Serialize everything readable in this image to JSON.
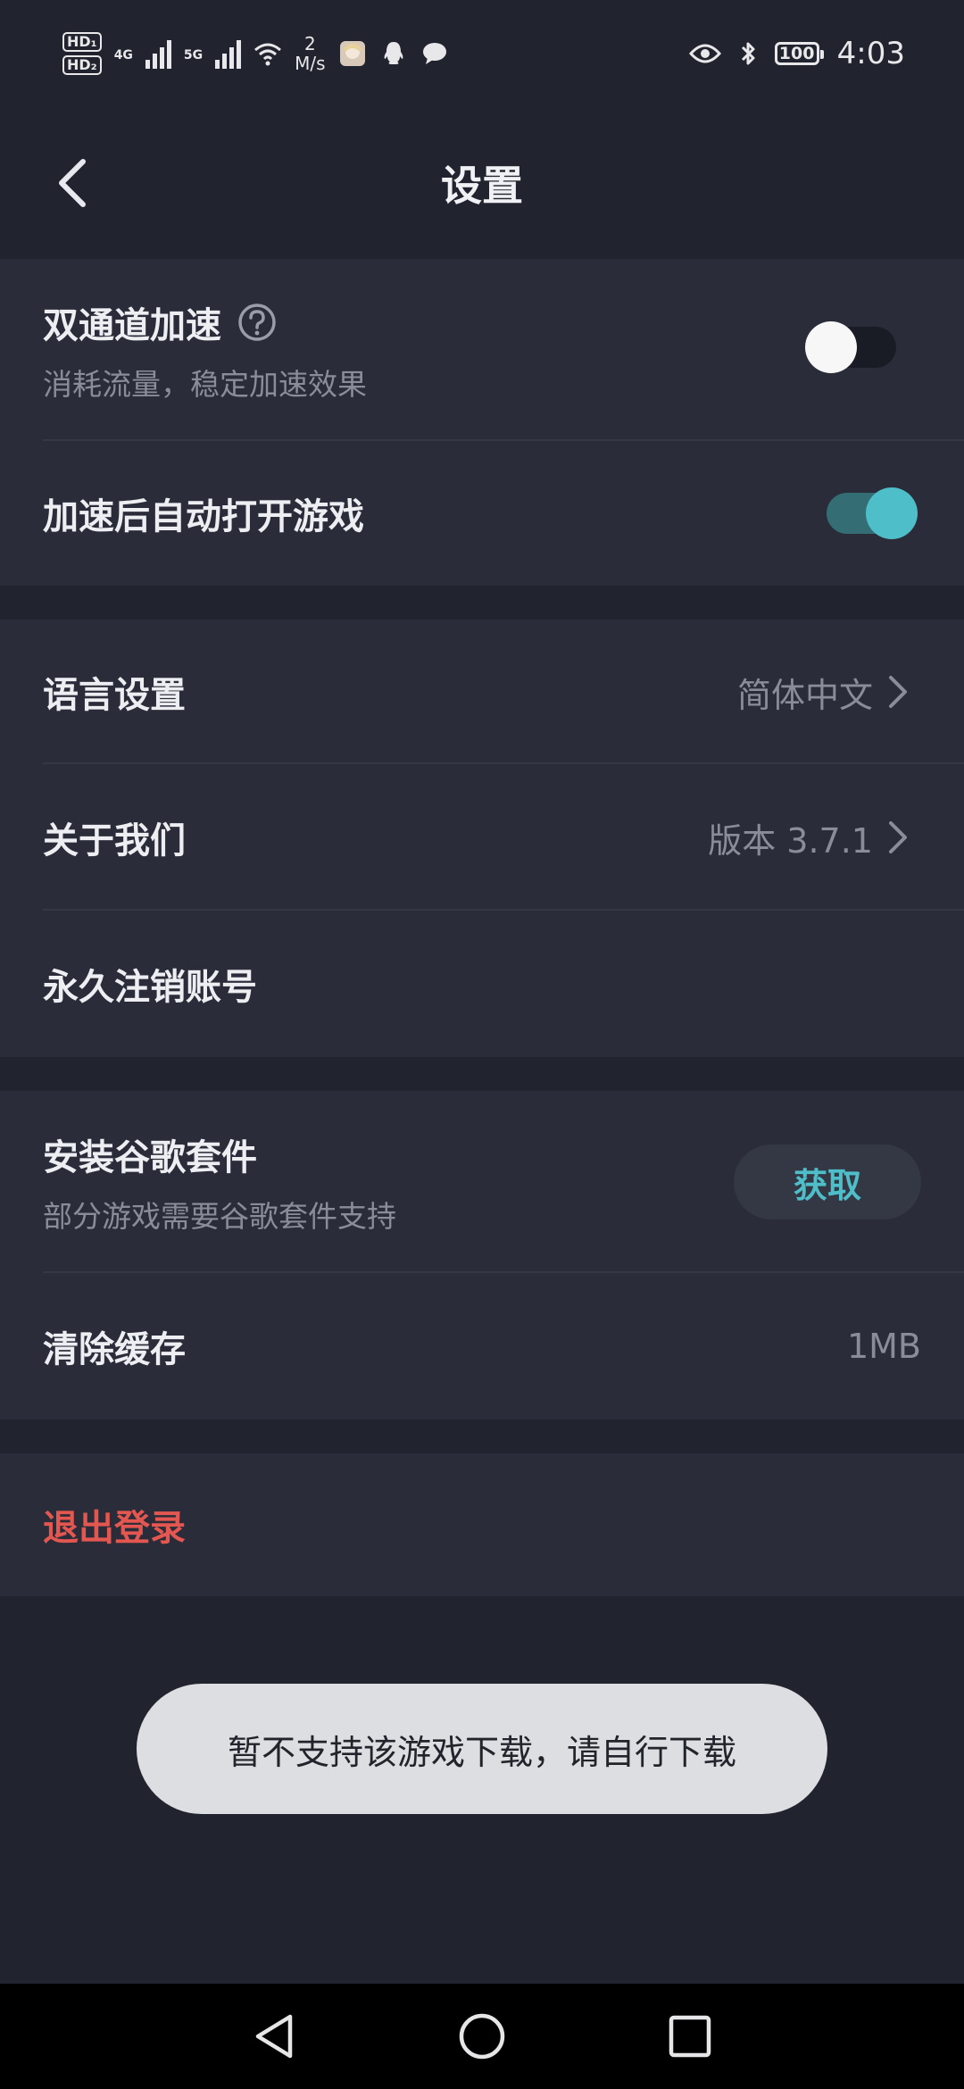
{
  "status_bar": {
    "hd1": "HD₁",
    "hd2": "HD₂",
    "net1": "4G",
    "net2": "5G",
    "speed_value": "2",
    "speed_unit": "M/s",
    "battery": "100",
    "time": "4:03"
  },
  "header": {
    "title": "设置"
  },
  "sections": {
    "acceleration": {
      "dual_channel_title": "双通道加速",
      "dual_channel_subtitle": "消耗流量，稳定加速效果",
      "dual_channel_enabled": false,
      "auto_open_title": "加速后自动打开游戏",
      "auto_open_enabled": true
    },
    "general": {
      "language_title": "语言设置",
      "language_value": "简体中文",
      "about_title": "关于我们",
      "about_value": "版本 3.7.1",
      "delete_account_title": "永久注销账号"
    },
    "tools": {
      "google_title": "安装谷歌套件",
      "google_subtitle": "部分游戏需要谷歌套件支持",
      "google_button": "获取",
      "cache_title": "清除缓存",
      "cache_value": "1MB"
    },
    "account": {
      "logout_title": "退出登录"
    }
  },
  "toast": {
    "message": "暂不支持该游戏下载，请自行下载"
  },
  "colors": {
    "background": "#21232e",
    "card": "#2a2d39",
    "accent": "#4ebfc9",
    "danger": "#e45650",
    "toast_bg": "#dcdee1"
  },
  "icons": {
    "back": "back-arrow-icon",
    "help": "question-circle-icon",
    "chevron": "chevron-right-icon",
    "nav_back": "triangle-back-icon",
    "nav_home": "circle-home-icon",
    "nav_recent": "square-recent-icon"
  }
}
